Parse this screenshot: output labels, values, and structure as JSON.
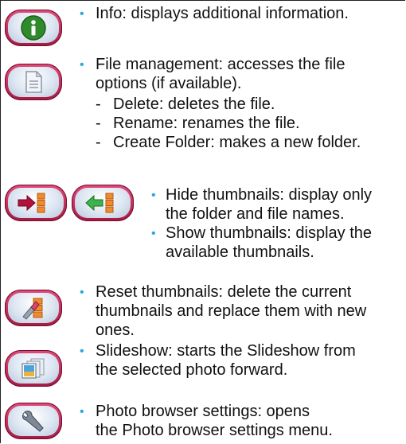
{
  "items": [
    {
      "icon": "info-icon",
      "text": "Info: displays additional information."
    },
    {
      "icon": "document-icon",
      "text_line1": "File management: accesses the file",
      "text_line2": "options (if available).",
      "subitems": [
        "Delete: deletes the file.",
        "Rename: renames the file.",
        "Create Folder: makes a new folder."
      ]
    },
    {
      "icons": [
        "hide-thumbnails-icon",
        "show-thumbnails-icon"
      ],
      "hide_line1": "Hide thumbnails: display only",
      "hide_line2": "the folder and file names.",
      "show_line1": "Show thumbnails: display the",
      "show_line2": "available thumbnails."
    },
    {
      "icon": "reset-thumbnails-icon",
      "line1": "Reset thumbnails: delete the current",
      "line2": "thumbnails and replace them with new",
      "line3": "ones."
    },
    {
      "icon": "slideshow-icon",
      "line1": "Slideshow: starts the Slideshow from",
      "line2": "the selected photo forward."
    },
    {
      "icon": "wrench-icon",
      "line1": "Photo browser settings: opens",
      "line2": "the Photo browser settings menu."
    }
  ],
  "bullet_char": "•",
  "dash_char": "-",
  "colors": {
    "pill": "#c92558",
    "bullet": "#2aa6df"
  }
}
